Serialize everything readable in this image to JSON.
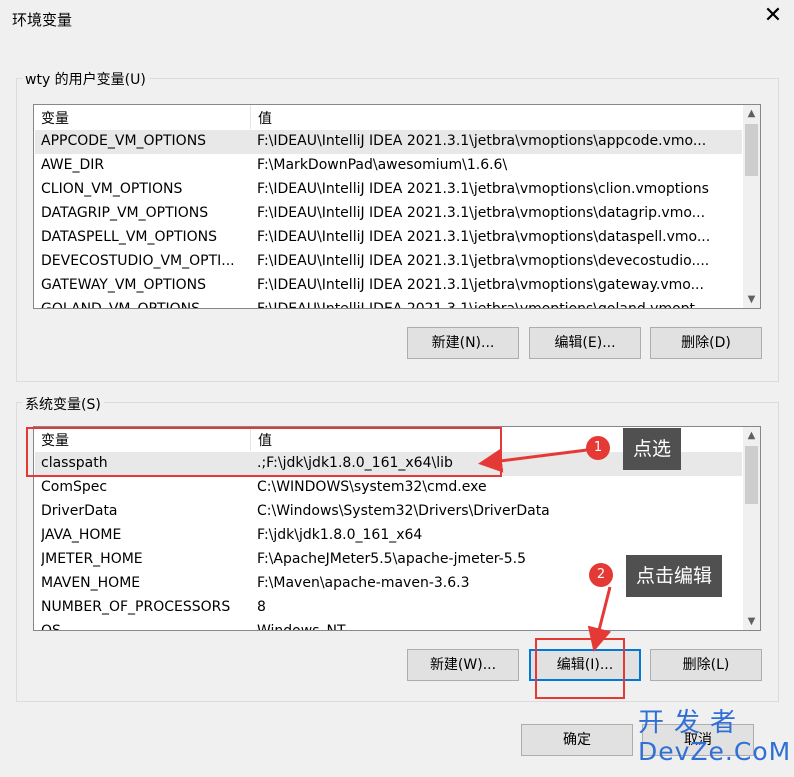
{
  "window": {
    "title": "环境变量",
    "close_symbol": "✕"
  },
  "user_vars": {
    "group_label": "wty 的用户变量(U)",
    "col_name": "变量",
    "col_value": "值",
    "rows": [
      {
        "name": "APPCODE_VM_OPTIONS",
        "value": "F:\\IDEAU\\IntelliJ IDEA 2021.3.1\\jetbra\\vmoptions\\appcode.vmo..."
      },
      {
        "name": "AWE_DIR",
        "value": "F:\\MarkDownPad\\awesomium\\1.6.6\\"
      },
      {
        "name": "CLION_VM_OPTIONS",
        "value": "F:\\IDEAU\\IntelliJ IDEA 2021.3.1\\jetbra\\vmoptions\\clion.vmoptions"
      },
      {
        "name": "DATAGRIP_VM_OPTIONS",
        "value": "F:\\IDEAU\\IntelliJ IDEA 2021.3.1\\jetbra\\vmoptions\\datagrip.vmo..."
      },
      {
        "name": "DATASPELL_VM_OPTIONS",
        "value": "F:\\IDEAU\\IntelliJ IDEA 2021.3.1\\jetbra\\vmoptions\\dataspell.vmo..."
      },
      {
        "name": "DEVECOSTUDIO_VM_OPTI...",
        "value": "F:\\IDEAU\\IntelliJ IDEA 2021.3.1\\jetbra\\vmoptions\\devecostudio...."
      },
      {
        "name": "GATEWAY_VM_OPTIONS",
        "value": "F:\\IDEAU\\IntelliJ IDEA 2021.3.1\\jetbra\\vmoptions\\gateway.vmo..."
      },
      {
        "name": "GOLAND_VM_OPTIONS",
        "value": "F:\\IDEAU\\IntelliJ IDEA 2021.3.1\\jetbra\\vmoptions\\goland.vmopt..."
      }
    ],
    "new_btn": "新建(N)...",
    "edit_btn": "编辑(E)...",
    "delete_btn": "删除(D)"
  },
  "system_vars": {
    "group_label": "系统变量(S)",
    "col_name": "变量",
    "col_value": "值",
    "rows": [
      {
        "name": "classpath",
        "value": ".;F:\\jdk\\jdk1.8.0_161_x64\\lib"
      },
      {
        "name": "ComSpec",
        "value": "C:\\WINDOWS\\system32\\cmd.exe"
      },
      {
        "name": "DriverData",
        "value": "C:\\Windows\\System32\\Drivers\\DriverData"
      },
      {
        "name": "JAVA_HOME",
        "value": "F:\\jdk\\jdk1.8.0_161_x64"
      },
      {
        "name": "JMETER_HOME",
        "value": "F:\\ApacheJMeter5.5\\apache-jmeter-5.5"
      },
      {
        "name": "MAVEN_HOME",
        "value": "F:\\Maven\\apache-maven-3.6.3"
      },
      {
        "name": "NUMBER_OF_PROCESSORS",
        "value": "8"
      },
      {
        "name": "OS",
        "value": "Windows_NT"
      }
    ],
    "new_btn": "新建(W)...",
    "edit_btn": "编辑(I)...",
    "delete_btn": "删除(L)"
  },
  "footer": {
    "ok_btn": "确定",
    "cancel_btn": "取消"
  },
  "annotations": {
    "step1_number": "1",
    "step1_text": "点选",
    "step2_number": "2",
    "step2_text": "点击编辑",
    "highlight_color": "#e53935"
  },
  "watermark": {
    "line1": "开发者",
    "line2": "DevZe.CoM"
  }
}
